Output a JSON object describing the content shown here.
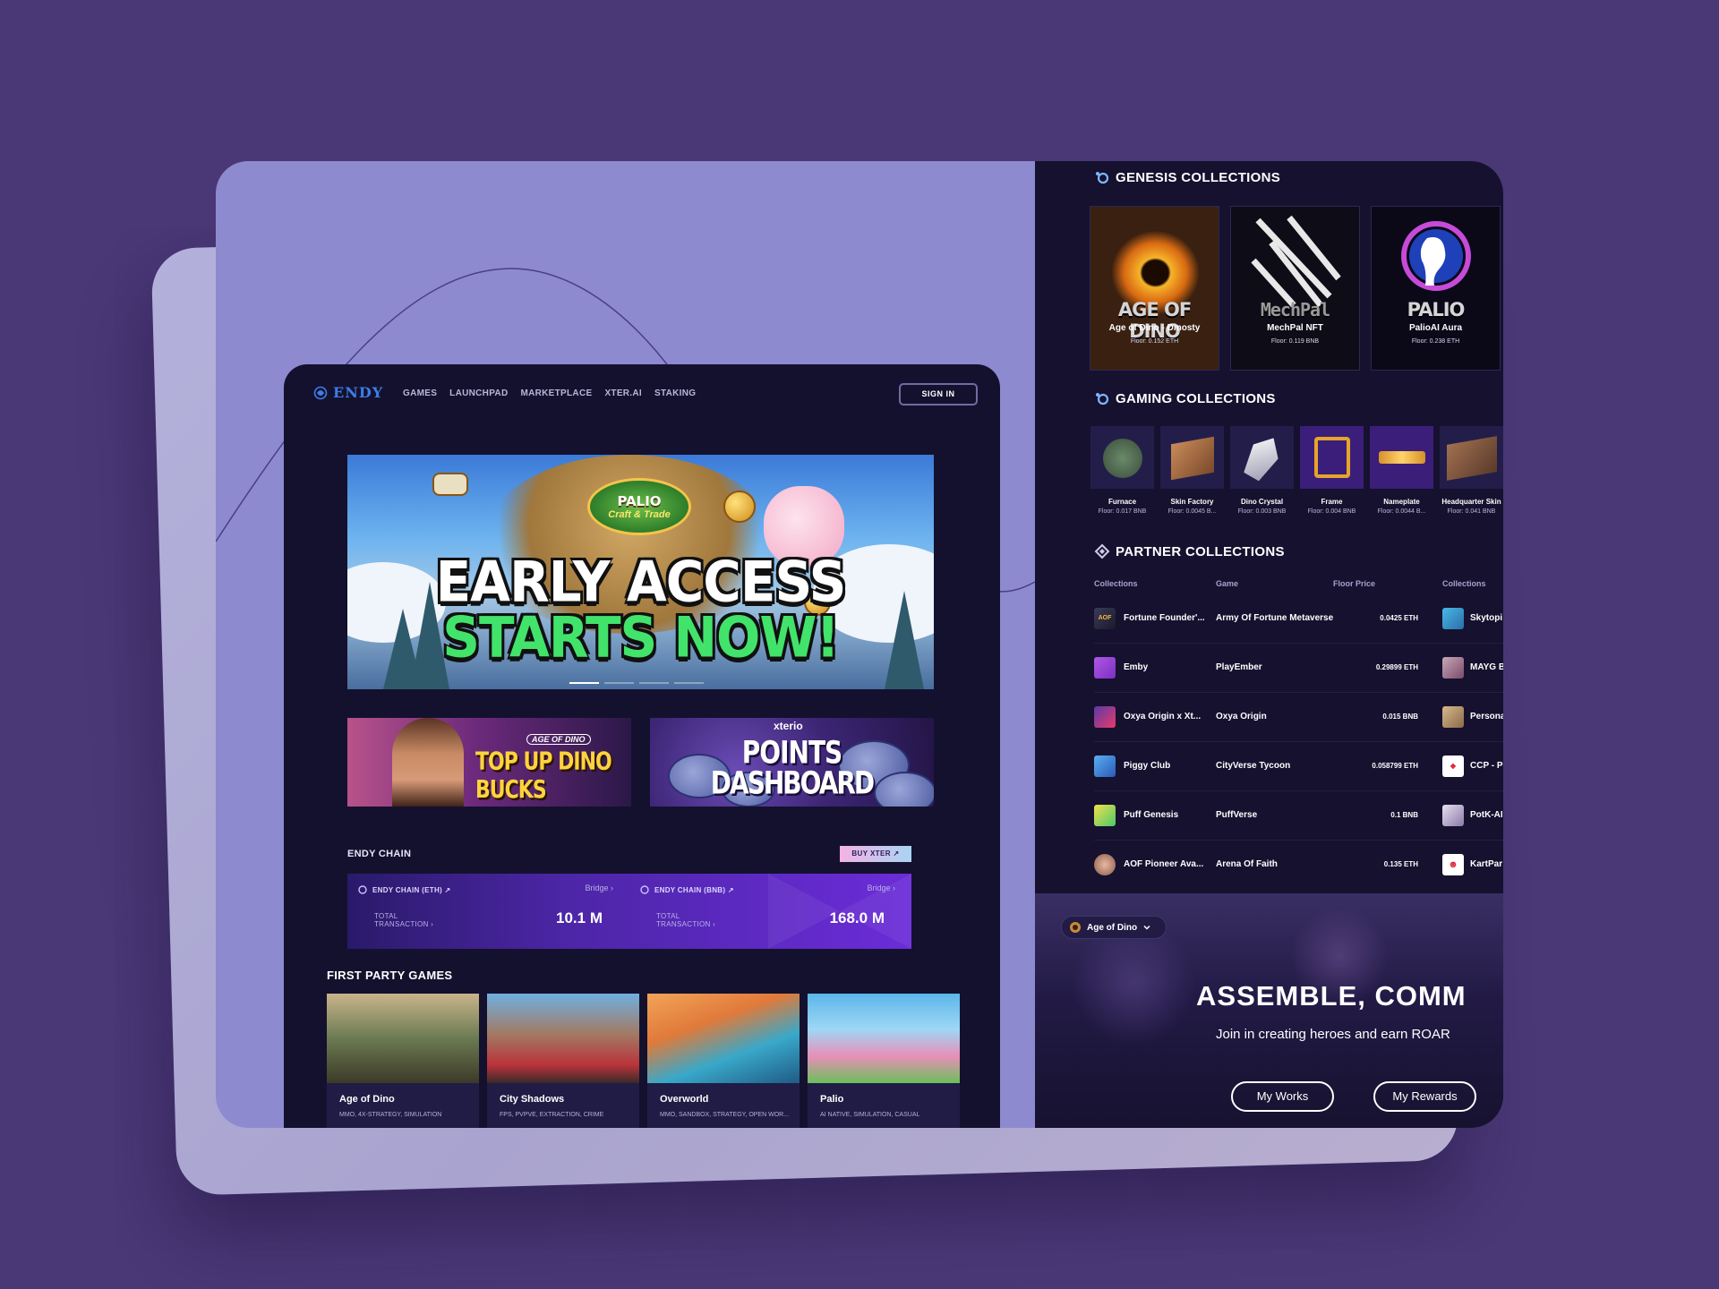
{
  "nav": {
    "logo": "ENDY",
    "links": [
      "GAMES",
      "LAUNCHPAD",
      "MARKETPLACE",
      "XTER.AI",
      "STAKING"
    ],
    "sign_in": "SIGN IN"
  },
  "hero": {
    "badge_title": "PALIO",
    "badge_subtitle": "Craft & Trade",
    "line1": "EARLY ACCESS",
    "line2": "STARTS NOW!",
    "slide_count": 4,
    "active_slide": 1
  },
  "promos": [
    {
      "badge": "AGE OF DINO",
      "title": "TOP UP DINO BUCKS"
    },
    {
      "brand": "xterio",
      "title_line1": "POINTS",
      "title_line2": "DASHBOARD"
    }
  ],
  "endy_chain": {
    "title": "ENDY CHAIN",
    "buy_button": "BUY XTER ↗",
    "chains": [
      {
        "label": "ENDY CHAIN   (ETH) ↗",
        "bridge": "Bridge ›",
        "total_label": "TOTAL TRANSACTION ›",
        "value": "10.1 M"
      },
      {
        "label": "ENDY CHAIN (BNB) ↗",
        "bridge": "Bridge ›",
        "total_label": "TOTAL TRANSACTION ›",
        "value": "168.0 M"
      }
    ]
  },
  "first_party": {
    "title": "FIRST PARTY GAMES",
    "games": [
      {
        "name": "Age of Dino",
        "tags": "MMO, 4X-STRATEGY, SIMULATION"
      },
      {
        "name": "City Shadows",
        "tags": "FPS, PVPVE, EXTRACTION, CRIME"
      },
      {
        "name": "Overworld",
        "tags": "MMO, SANDBOX, STRATEGY, OPEN WOR..."
      },
      {
        "name": "Palio",
        "tags": "AI NATIVE, SIMULATION, CASUAL"
      }
    ]
  },
  "genesis": {
    "title": "GENESIS COLLECTIONS",
    "items": [
      {
        "logo": "AGE OF DINO",
        "name": "Age of Dino - Dinosty",
        "floor": "Floor: 0.152 ETH"
      },
      {
        "logo": "MechPal",
        "name": "MechPal NFT",
        "floor": "Floor: 0.119 BNB"
      },
      {
        "logo": "PALIO",
        "name": "PalioAI Aura",
        "floor": "Floor: 0.238 ETH"
      }
    ]
  },
  "gaming": {
    "title": "GAMING COLLECTIONS",
    "items": [
      {
        "name": "Furnace",
        "floor": "Floor: 0.017 BNB"
      },
      {
        "name": "Skin Factory",
        "floor": "Floor: 0.0045 B..."
      },
      {
        "name": "Dino Crystal",
        "floor": "Floor: 0.003 BNB"
      },
      {
        "name": "Frame",
        "floor": "Floor: 0.004 BNB"
      },
      {
        "name": "Nameplate",
        "floor": "Floor: 0.0044 B..."
      },
      {
        "name": "Headquarter Skin",
        "floor": "Floor: 0.041 BNB"
      }
    ]
  },
  "partner": {
    "title": "PARTNER COLLECTIONS",
    "headers": {
      "collections": "Collections",
      "game": "Game",
      "floor": "Floor Price",
      "collections2": "Collections"
    },
    "rows": [
      {
        "collection": "Fortune Founder'...",
        "game": "Army Of Fortune Metaverse",
        "price": "0.0425 ETH",
        "collection2": "Skytopi"
      },
      {
        "collection": "Emby",
        "game": "PlayEmber",
        "price": "0.29899 ETH",
        "collection2": "MAYG B"
      },
      {
        "collection": "Oxya Origin x Xt...",
        "game": "Oxya Origin",
        "price": "0.015 BNB",
        "collection2": "Persona"
      },
      {
        "collection": "Piggy Club",
        "game": "CityVerse Tycoon",
        "price": "0.058799 ETH",
        "collection2": "CCP - P"
      },
      {
        "collection": "Puff Genesis",
        "game": "PuffVerse",
        "price": "0.1 BNB",
        "collection2": "PotK-AI"
      },
      {
        "collection": "AOF Pioneer Ava...",
        "game": "Arena Of Faith",
        "price": "0.135 ETH",
        "collection2": "KartPar"
      }
    ]
  },
  "assemble": {
    "selector": "Age of Dino",
    "title": "ASSEMBLE, COMM",
    "subtitle": "Join in creating heroes and earn ROAR",
    "btn_works": "My Works",
    "btn_rewards": "My Rewards"
  },
  "colors": {
    "background": "#4a3776",
    "card": "#8d8ad0",
    "dark": "#15112f",
    "accent_blue": "#3d7de6",
    "accent_green": "#42e36a"
  }
}
